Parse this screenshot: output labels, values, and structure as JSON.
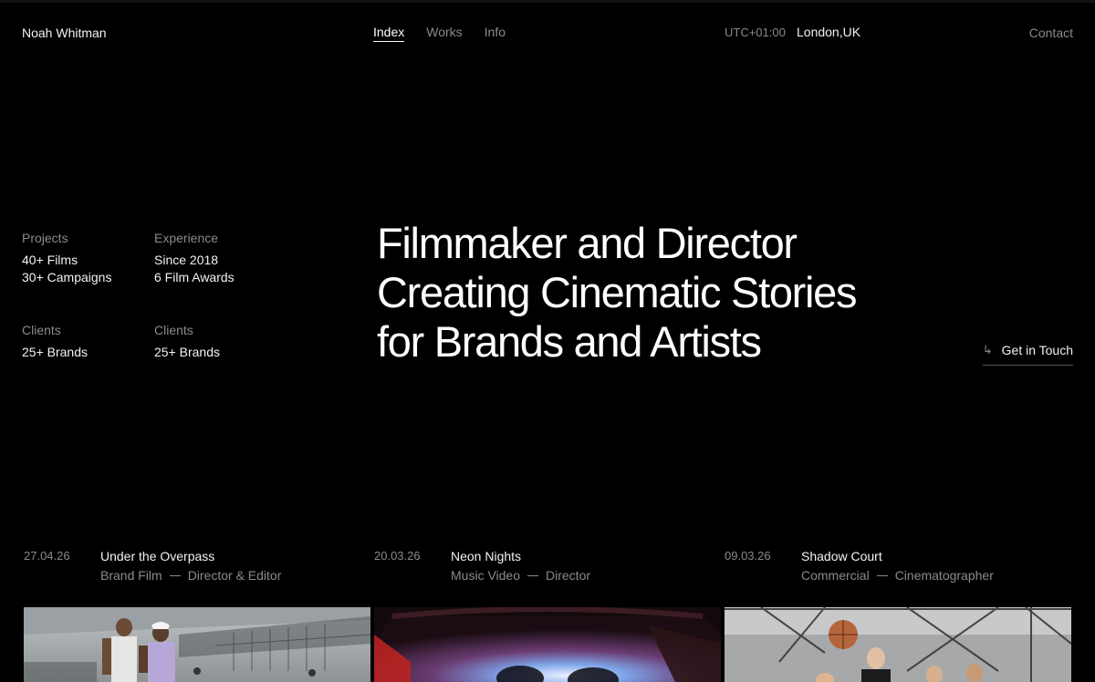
{
  "header": {
    "brand": "Noah Whitman",
    "nav": [
      {
        "label": "Index",
        "active": true
      },
      {
        "label": "Works",
        "active": false
      },
      {
        "label": "Info",
        "active": false
      }
    ],
    "timezone": "UTC+01:00",
    "location": "London,UK",
    "contact": "Contact"
  },
  "stats": [
    {
      "label": "Projects",
      "lines": [
        "40+ Films",
        "30+ Campaigns"
      ]
    },
    {
      "label": "Experience",
      "lines": [
        "Since 2018",
        "6 Film Awards"
      ]
    },
    {
      "label": "Clients",
      "lines": [
        "25+ Brands"
      ]
    },
    {
      "label": "Clients",
      "lines": [
        "25+ Brands"
      ]
    }
  ],
  "hero": {
    "lines": [
      "Filmmaker and Director",
      "Creating Cinematic Stories",
      "for Brands and Artists"
    ]
  },
  "cta": {
    "icon": "arrow-down-right-icon",
    "glyph": "↳",
    "label": "Get in Touch"
  },
  "projects": [
    {
      "date": "27.04.26",
      "title": "Under the Overpass",
      "type": "Brand Film",
      "role": "Director & Editor"
    },
    {
      "date": "20.03.26",
      "title": "Neon Nights",
      "type": "Music Video",
      "role": "Director"
    },
    {
      "date": "09.03.26",
      "title": "Shadow Court",
      "type": "Commercial",
      "role": "Cinematographer"
    }
  ],
  "colors": {
    "background": "#000000",
    "text": "#ffffff",
    "muted": "#8a8a8a"
  }
}
